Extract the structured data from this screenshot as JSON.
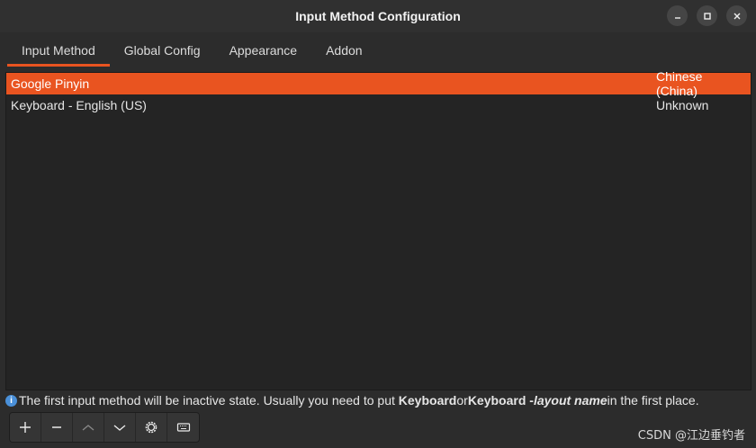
{
  "window": {
    "title": "Input Method Configuration",
    "buttons": [
      "minimize-icon",
      "maximize-icon",
      "close-icon"
    ]
  },
  "tabs": [
    {
      "label": "Input Method",
      "active": true
    },
    {
      "label": "Global Config",
      "active": false
    },
    {
      "label": "Appearance",
      "active": false
    },
    {
      "label": "Addon",
      "active": false
    }
  ],
  "input_methods": [
    {
      "name": "Google Pinyin",
      "language": "Chinese (China)",
      "selected": true
    },
    {
      "name": "Keyboard - English (US)",
      "language": "Unknown",
      "selected": false
    }
  ],
  "info": {
    "icon": "info-icon",
    "text_1": "The first input method will be inactive state. Usually you need to put ",
    "bold_1": "Keyboard",
    "text_2": " or ",
    "bold_2": "Keyboard - ",
    "italic_bold": "layout name",
    "text_3": " in the first place."
  },
  "toolbar": {
    "buttons": [
      "add-icon",
      "remove-icon",
      "move-up-icon",
      "move-down-icon",
      "configure-icon",
      "keyboard-icon"
    ]
  },
  "watermark": "CSDN @江边垂钓者",
  "colors": {
    "accent": "#e95420",
    "background": "#2c2c2c",
    "list_background": "#242424"
  }
}
